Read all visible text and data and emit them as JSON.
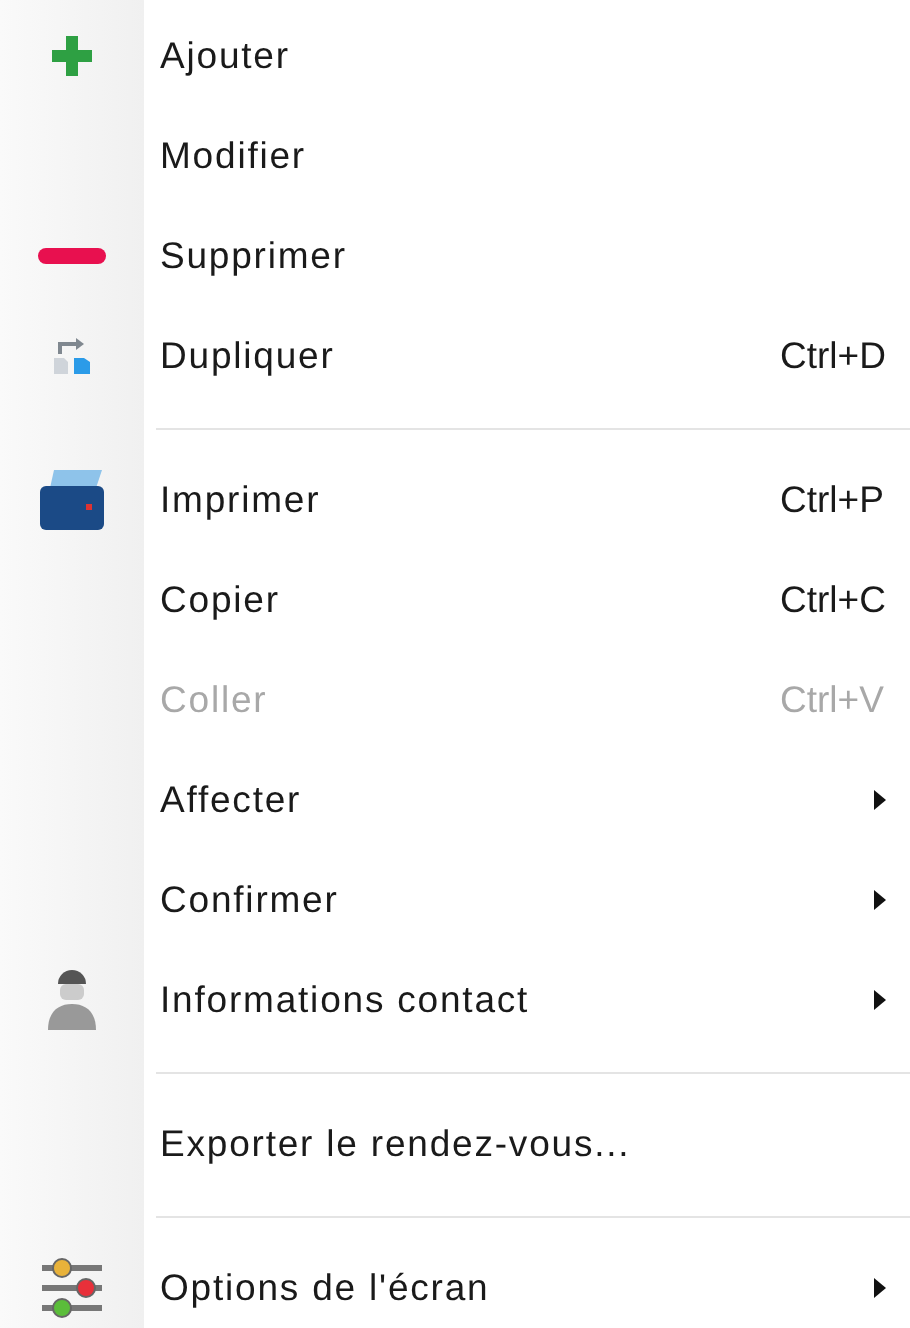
{
  "menu": {
    "items": [
      {
        "kind": "plus",
        "label": "Ajouter",
        "disabled": false
      },
      {
        "kind": "plain",
        "label": "Modifier",
        "disabled": false
      },
      {
        "kind": "minus",
        "label": "Supprimer",
        "disabled": false
      },
      {
        "kind": "duplicate",
        "label": "Dupliquer",
        "shortcut": "Ctrl+D",
        "disabled": false
      },
      {
        "kind": "separator"
      },
      {
        "kind": "printer",
        "label": "Imprimer",
        "shortcut": "Ctrl+P",
        "disabled": false
      },
      {
        "kind": "plain",
        "label": "Copier",
        "shortcut": "Ctrl+C",
        "disabled": false
      },
      {
        "kind": "plain",
        "label": "Coller",
        "shortcut": "Ctrl+V",
        "disabled": true
      },
      {
        "kind": "plain",
        "label": "Affecter",
        "submenu": true,
        "disabled": false
      },
      {
        "kind": "plain",
        "label": "Confirmer",
        "submenu": true,
        "disabled": false
      },
      {
        "kind": "contact",
        "label": "Informations contact",
        "submenu": true,
        "disabled": false
      },
      {
        "kind": "separator"
      },
      {
        "kind": "plain",
        "label": "Exporter le rendez-vous...",
        "disabled": false
      },
      {
        "kind": "separator"
      },
      {
        "kind": "options",
        "label": "Options de l'écran",
        "submenu": true,
        "disabled": false
      }
    ]
  }
}
